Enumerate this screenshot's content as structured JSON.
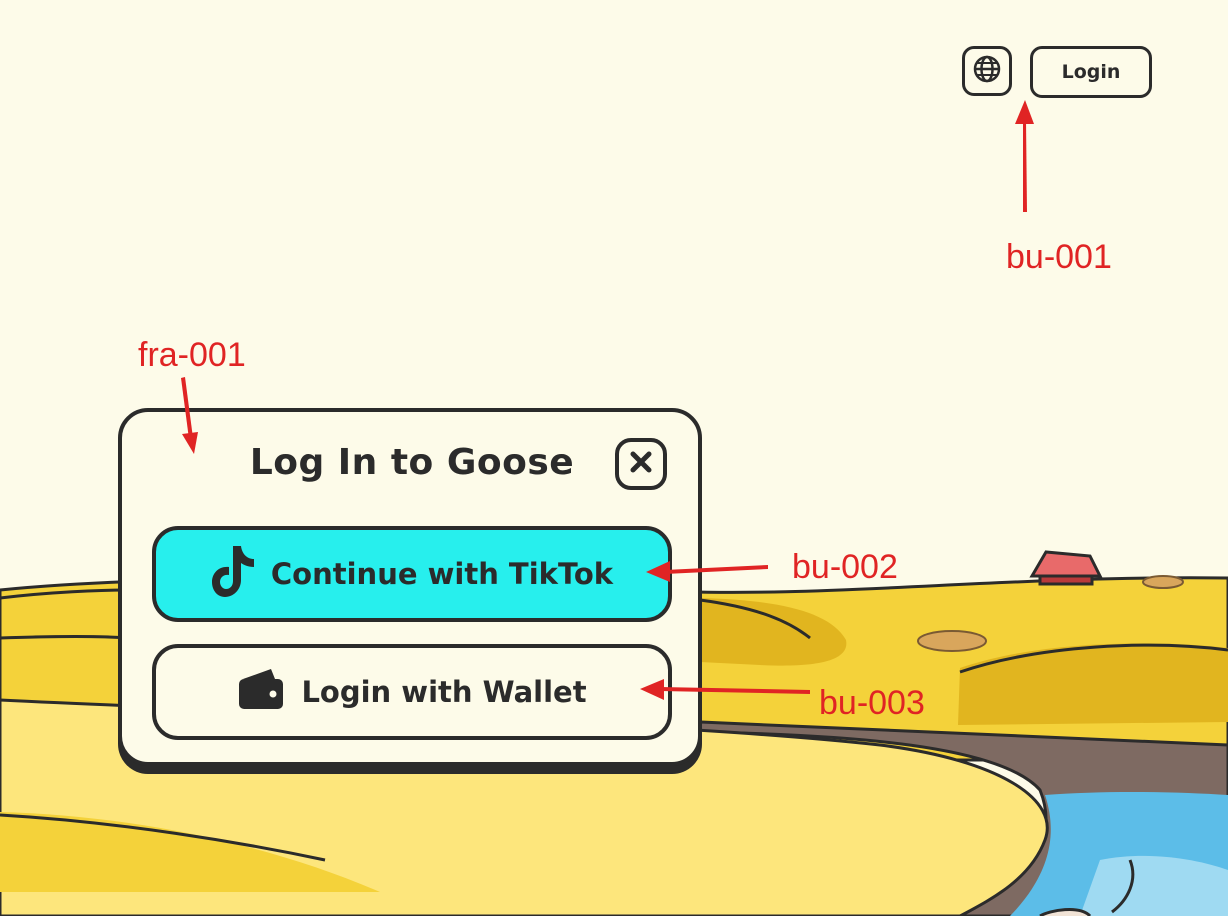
{
  "header": {
    "language_icon": "globe-icon",
    "login_label": "Login"
  },
  "modal": {
    "title": "Log In to Goose",
    "close_icon": "close-icon",
    "tiktok_button": {
      "label": "Continue with TikTok",
      "icon": "tiktok-icon",
      "color": "#27efed"
    },
    "wallet_button": {
      "label": "Login with Wallet",
      "icon": "wallet-icon"
    }
  },
  "annotations": {
    "bu_001": "bu-001",
    "fra_001": "fra-001",
    "bu_002": "bu-002",
    "bu_003": "bu-003"
  },
  "colors": {
    "background": "#fdfbe9",
    "field_yellow": "#f4d23a",
    "river_blue": "#5cbde8",
    "outline": "#2b2b2b",
    "annotation_red": "#e02424"
  }
}
